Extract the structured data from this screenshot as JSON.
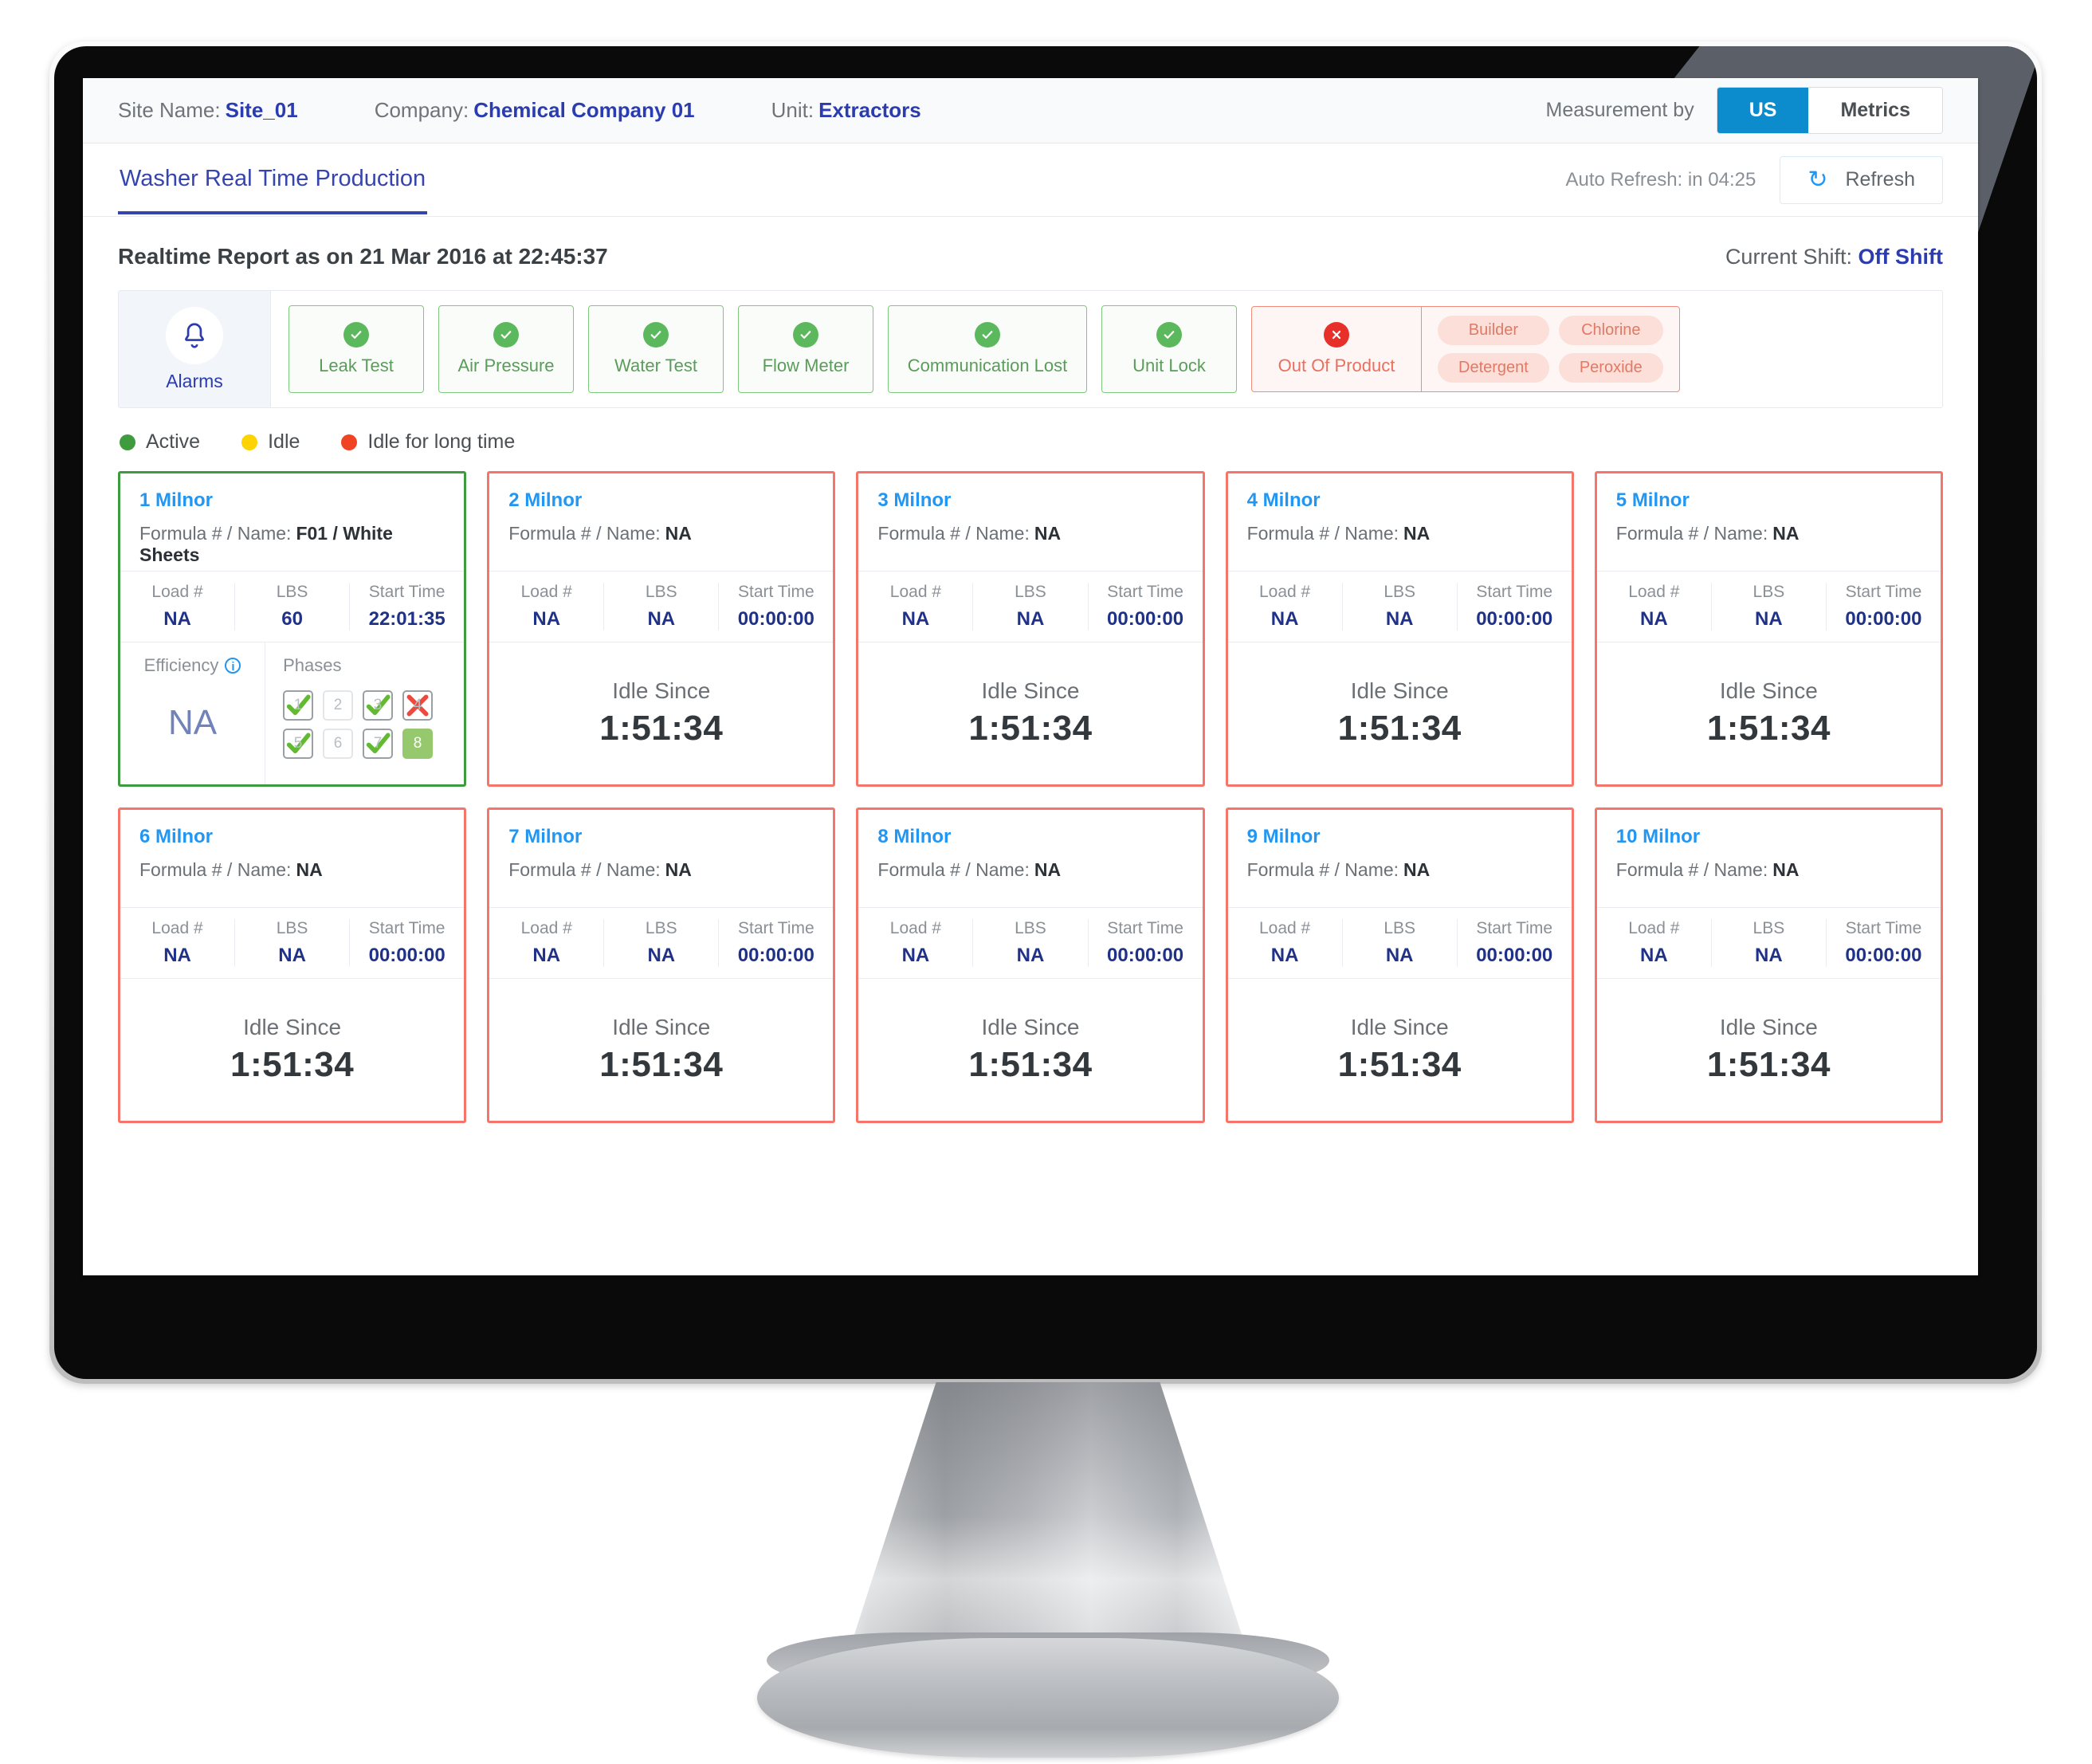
{
  "header": {
    "site_label": "Site Name:",
    "site_value": "Site_01",
    "company_label": "Company:",
    "company_value": "Chemical Company 01",
    "unit_label": "Unit:",
    "unit_value": "Extractors",
    "measurement_label": "Measurement by",
    "measurement_options": [
      "US",
      "Metrics"
    ],
    "measurement_selected": "US"
  },
  "tabbar": {
    "tab_label": "Washer Real Time Production",
    "auto_refresh": "Auto Refresh: in 04:25",
    "refresh_label": "Refresh",
    "refresh_icon": "refresh-icon"
  },
  "report": {
    "title": "Realtime Report as on 21 Mar 2016 at 22:45:37",
    "shift_label": "Current Shift:",
    "shift_value": "Off Shift"
  },
  "alarms": {
    "panel_label": "Alarms",
    "bell_icon": "bell-icon",
    "items": [
      {
        "label": "Leak Test",
        "status": "ok",
        "icon": "check-circle-icon"
      },
      {
        "label": "Air Pressure",
        "status": "ok",
        "icon": "check-circle-icon"
      },
      {
        "label": "Water Test",
        "status": "ok",
        "icon": "check-circle-icon"
      },
      {
        "label": "Flow Meter",
        "status": "ok",
        "icon": "check-circle-icon"
      },
      {
        "label": "Communication Lost",
        "status": "ok",
        "icon": "check-circle-icon"
      },
      {
        "label": "Unit Lock",
        "status": "ok",
        "icon": "check-circle-icon"
      }
    ],
    "out_of_product": {
      "label": "Out Of Product",
      "icon": "error-circle-icon",
      "chemicals": [
        "Builder",
        "Chlorine",
        "Detergent",
        "Peroxide"
      ]
    }
  },
  "legend": [
    {
      "label": "Active",
      "color": "#3e9b3e"
    },
    {
      "label": "Idle",
      "color": "#fdd400"
    },
    {
      "label": "Idle for long time",
      "color": "#ef4323"
    }
  ],
  "card_labels": {
    "formula": "Formula # / Name:",
    "load": "Load #",
    "lbs": "LBS",
    "start_time": "Start Time",
    "efficiency": "Efficiency",
    "phases": "Phases",
    "idle_since": "Idle Since"
  },
  "machines": [
    {
      "title": "1 Milnor",
      "state": "active",
      "formula": "F01 / White Sheets",
      "load": "NA",
      "lbs": "60",
      "start_time": "22:01:35",
      "efficiency": "NA",
      "phases": [
        {
          "num": "1",
          "state": "done"
        },
        {
          "num": "2",
          "state": "pending"
        },
        {
          "num": "3",
          "state": "done"
        },
        {
          "num": "4",
          "state": "fail"
        },
        {
          "num": "5",
          "state": "done"
        },
        {
          "num": "6",
          "state": "pending"
        },
        {
          "num": "7",
          "state": "done"
        },
        {
          "num": "8",
          "state": "current"
        }
      ]
    },
    {
      "title": "2 Milnor",
      "state": "idle-long",
      "formula": "NA",
      "load": "NA",
      "lbs": "NA",
      "start_time": "00:00:00",
      "idle_since": "1:51:34"
    },
    {
      "title": "3 Milnor",
      "state": "idle-long",
      "formula": "NA",
      "load": "NA",
      "lbs": "NA",
      "start_time": "00:00:00",
      "idle_since": "1:51:34"
    },
    {
      "title": "4 Milnor",
      "state": "idle-long",
      "formula": "NA",
      "load": "NA",
      "lbs": "NA",
      "start_time": "00:00:00",
      "idle_since": "1:51:34"
    },
    {
      "title": "5 Milnor",
      "state": "idle-long",
      "formula": "NA",
      "load": "NA",
      "lbs": "NA",
      "start_time": "00:00:00",
      "idle_since": "1:51:34"
    },
    {
      "title": "6 Milnor",
      "state": "idle-long",
      "formula": "NA",
      "load": "NA",
      "lbs": "NA",
      "start_time": "00:00:00",
      "idle_since": "1:51:34"
    },
    {
      "title": "7 Milnor",
      "state": "idle-long",
      "formula": "NA",
      "load": "NA",
      "lbs": "NA",
      "start_time": "00:00:00",
      "idle_since": "1:51:34"
    },
    {
      "title": "8 Milnor",
      "state": "idle-long",
      "formula": "NA",
      "load": "NA",
      "lbs": "NA",
      "start_time": "00:00:00",
      "idle_since": "1:51:34"
    },
    {
      "title": "9 Milnor",
      "state": "idle-long",
      "formula": "NA",
      "load": "NA",
      "lbs": "NA",
      "start_time": "00:00:00",
      "idle_since": "1:51:34"
    },
    {
      "title": "10 Milnor",
      "state": "idle-long",
      "formula": "NA",
      "load": "NA",
      "lbs": "NA",
      "start_time": "00:00:00",
      "idle_since": "1:51:34"
    }
  ]
}
